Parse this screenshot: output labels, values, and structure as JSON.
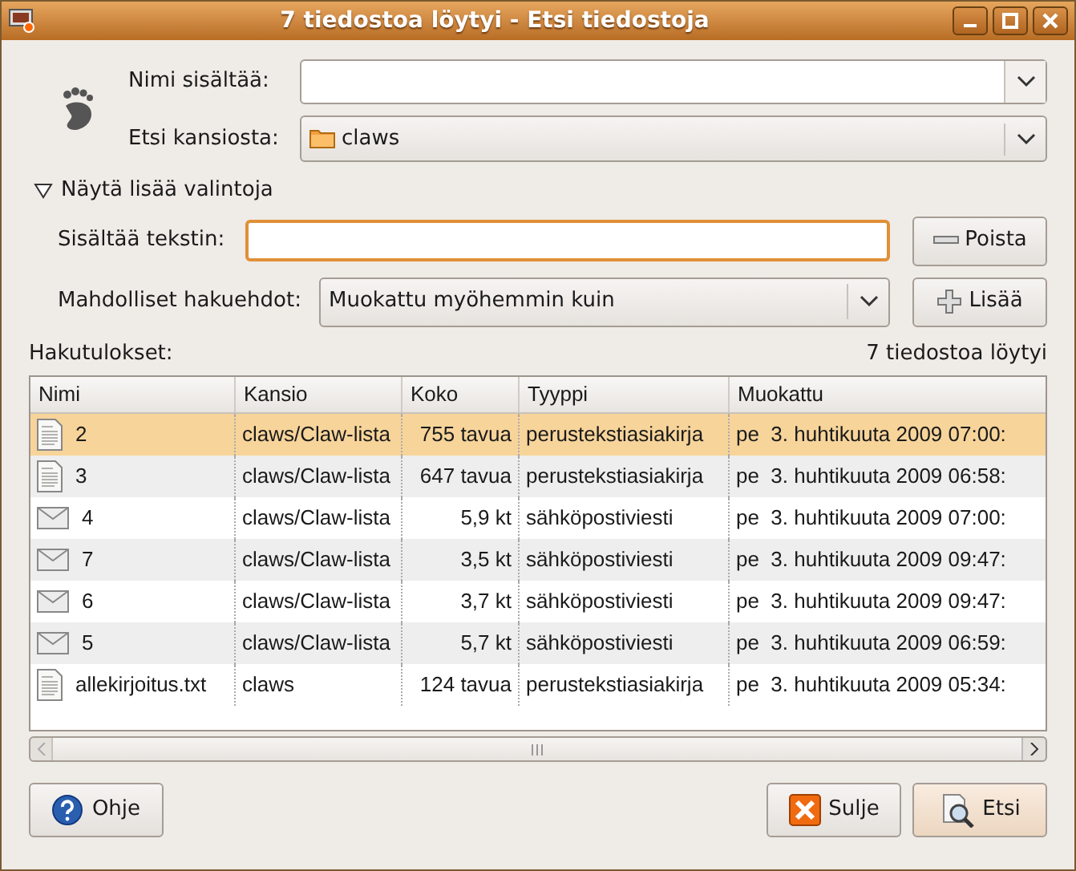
{
  "window": {
    "title": "7 tiedostoa löytyi - Etsi tiedostoja"
  },
  "name_field": {
    "label": "Nimi sisältää:"
  },
  "folder_field": {
    "label": "Etsi kansiosta:",
    "value": "claws"
  },
  "expander": {
    "label": "Näytä lisää valintoja",
    "expanded": true
  },
  "text_field": {
    "label": "Sisältää tekstin:",
    "focused": true
  },
  "remove_button": "Poista",
  "criteria": {
    "label": "Mahdolliset hakuehdot:",
    "value": "Muokattu myöhemmin kuin"
  },
  "add_button": "Lisää",
  "results": {
    "label": "Hakutulokset:",
    "count": "7 tiedostoa löytyi"
  },
  "table": {
    "columns": [
      "Nimi",
      "Kansio",
      "Koko",
      "Tyyppi",
      "Muokattu"
    ],
    "rows": [
      {
        "kind": "text",
        "selected": true,
        "cells": [
          "2",
          "claws/Claw-lista",
          "755 tavua",
          "perustekstiasiakirja",
          "pe  3. huhtikuuta 2009 07:00:"
        ]
      },
      {
        "kind": "text",
        "selected": false,
        "cells": [
          "3",
          "claws/Claw-lista",
          "647 tavua",
          "perustekstiasiakirja",
          "pe  3. huhtikuuta 2009 06:58:"
        ]
      },
      {
        "kind": "mail",
        "selected": false,
        "cells": [
          "4",
          "claws/Claw-lista",
          "5,9 kt",
          "sähköpostiviesti",
          "pe  3. huhtikuuta 2009 07:00:"
        ]
      },
      {
        "kind": "mail",
        "selected": false,
        "cells": [
          "7",
          "claws/Claw-lista",
          "3,5 kt",
          "sähköpostiviesti",
          "pe  3. huhtikuuta 2009 09:47:"
        ]
      },
      {
        "kind": "mail",
        "selected": false,
        "cells": [
          "6",
          "claws/Claw-lista",
          "3,7 kt",
          "sähköpostiviesti",
          "pe  3. huhtikuuta 2009 09:47:"
        ]
      },
      {
        "kind": "mail",
        "selected": false,
        "cells": [
          "5",
          "claws/Claw-lista",
          "5,7 kt",
          "sähköpostiviesti",
          "pe  3. huhtikuuta 2009 06:59:"
        ]
      },
      {
        "kind": "text",
        "selected": false,
        "cells": [
          "allekirjoitus.txt",
          "claws",
          "124 tavua",
          "perustekstiasiakirja",
          "pe  3. huhtikuuta 2009 05:34:"
        ]
      }
    ]
  },
  "buttons": {
    "help": "Ohje",
    "close": "Sulje",
    "find": "Etsi"
  }
}
